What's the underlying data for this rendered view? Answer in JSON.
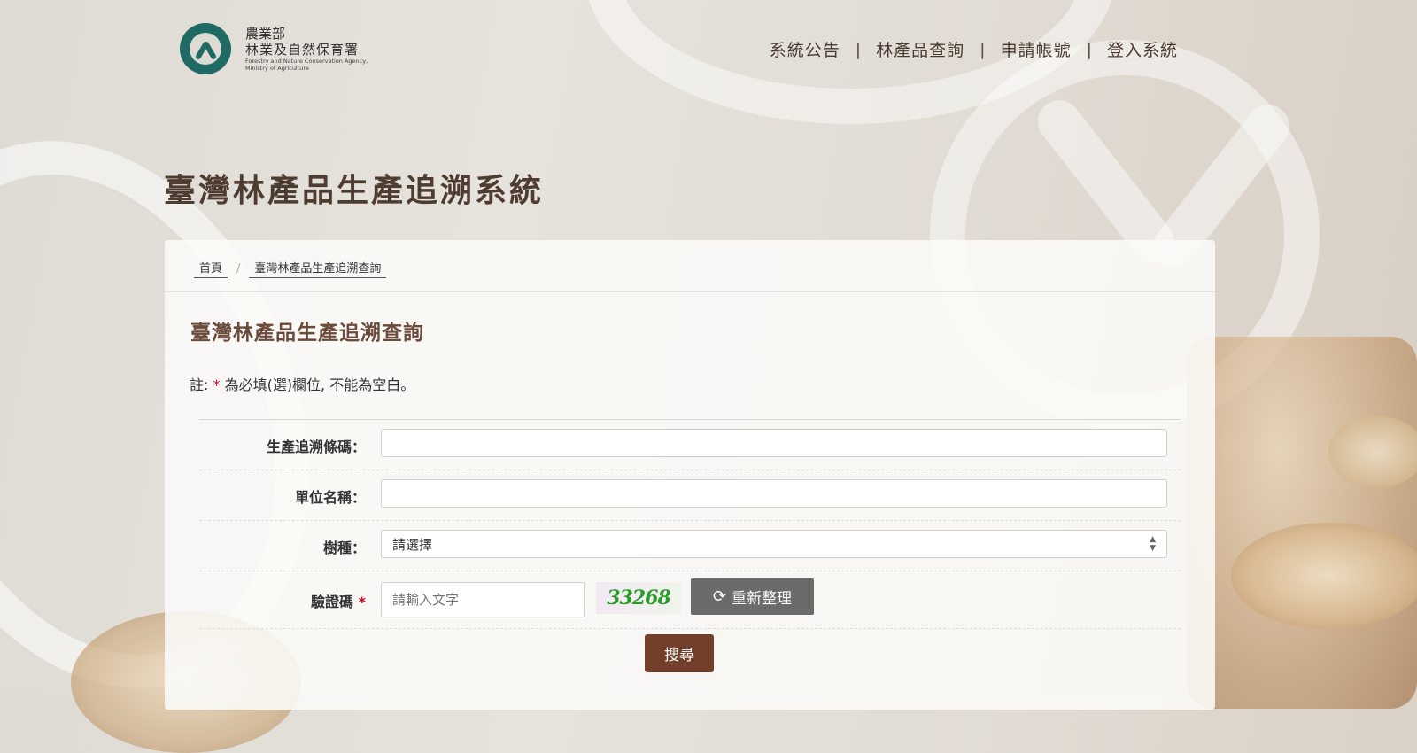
{
  "header": {
    "logo_line1": "農業部",
    "logo_line2": "林業及自然保育署",
    "logo_en1": "Forestry and Nature Conservation Agency,",
    "logo_en2": "Ministry of Agriculture",
    "nav": [
      "系統公告",
      "林產品查詢",
      "申請帳號",
      "登入系統"
    ],
    "nav_separator": "|"
  },
  "site_title": "臺灣林產品生產追溯系統",
  "breadcrumb": {
    "home": "首頁",
    "separator": "/",
    "current": "臺灣林產品生產追溯查詢"
  },
  "form": {
    "title": "臺灣林產品生產追溯查詢",
    "note_prefix": "註: ",
    "note_star": "*",
    "note_text": " 為必填(選)欄位, 不能為空白。",
    "fields": {
      "barcode": {
        "label": "生產追溯條碼：",
        "value": ""
      },
      "unit": {
        "label": "單位名稱：",
        "value": ""
      },
      "tree": {
        "label": "樹種：",
        "value": "請選擇"
      },
      "captcha": {
        "label": "驗證碼",
        "required": "*",
        "placeholder": "請輸入文字",
        "image_text": "33268"
      }
    },
    "refresh_label": "重新整理",
    "search_label": "搜尋"
  },
  "colors": {
    "brand": "#1f6a63",
    "title": "#4e3c31",
    "accent": "#713f2a",
    "required": "#d0021b"
  }
}
